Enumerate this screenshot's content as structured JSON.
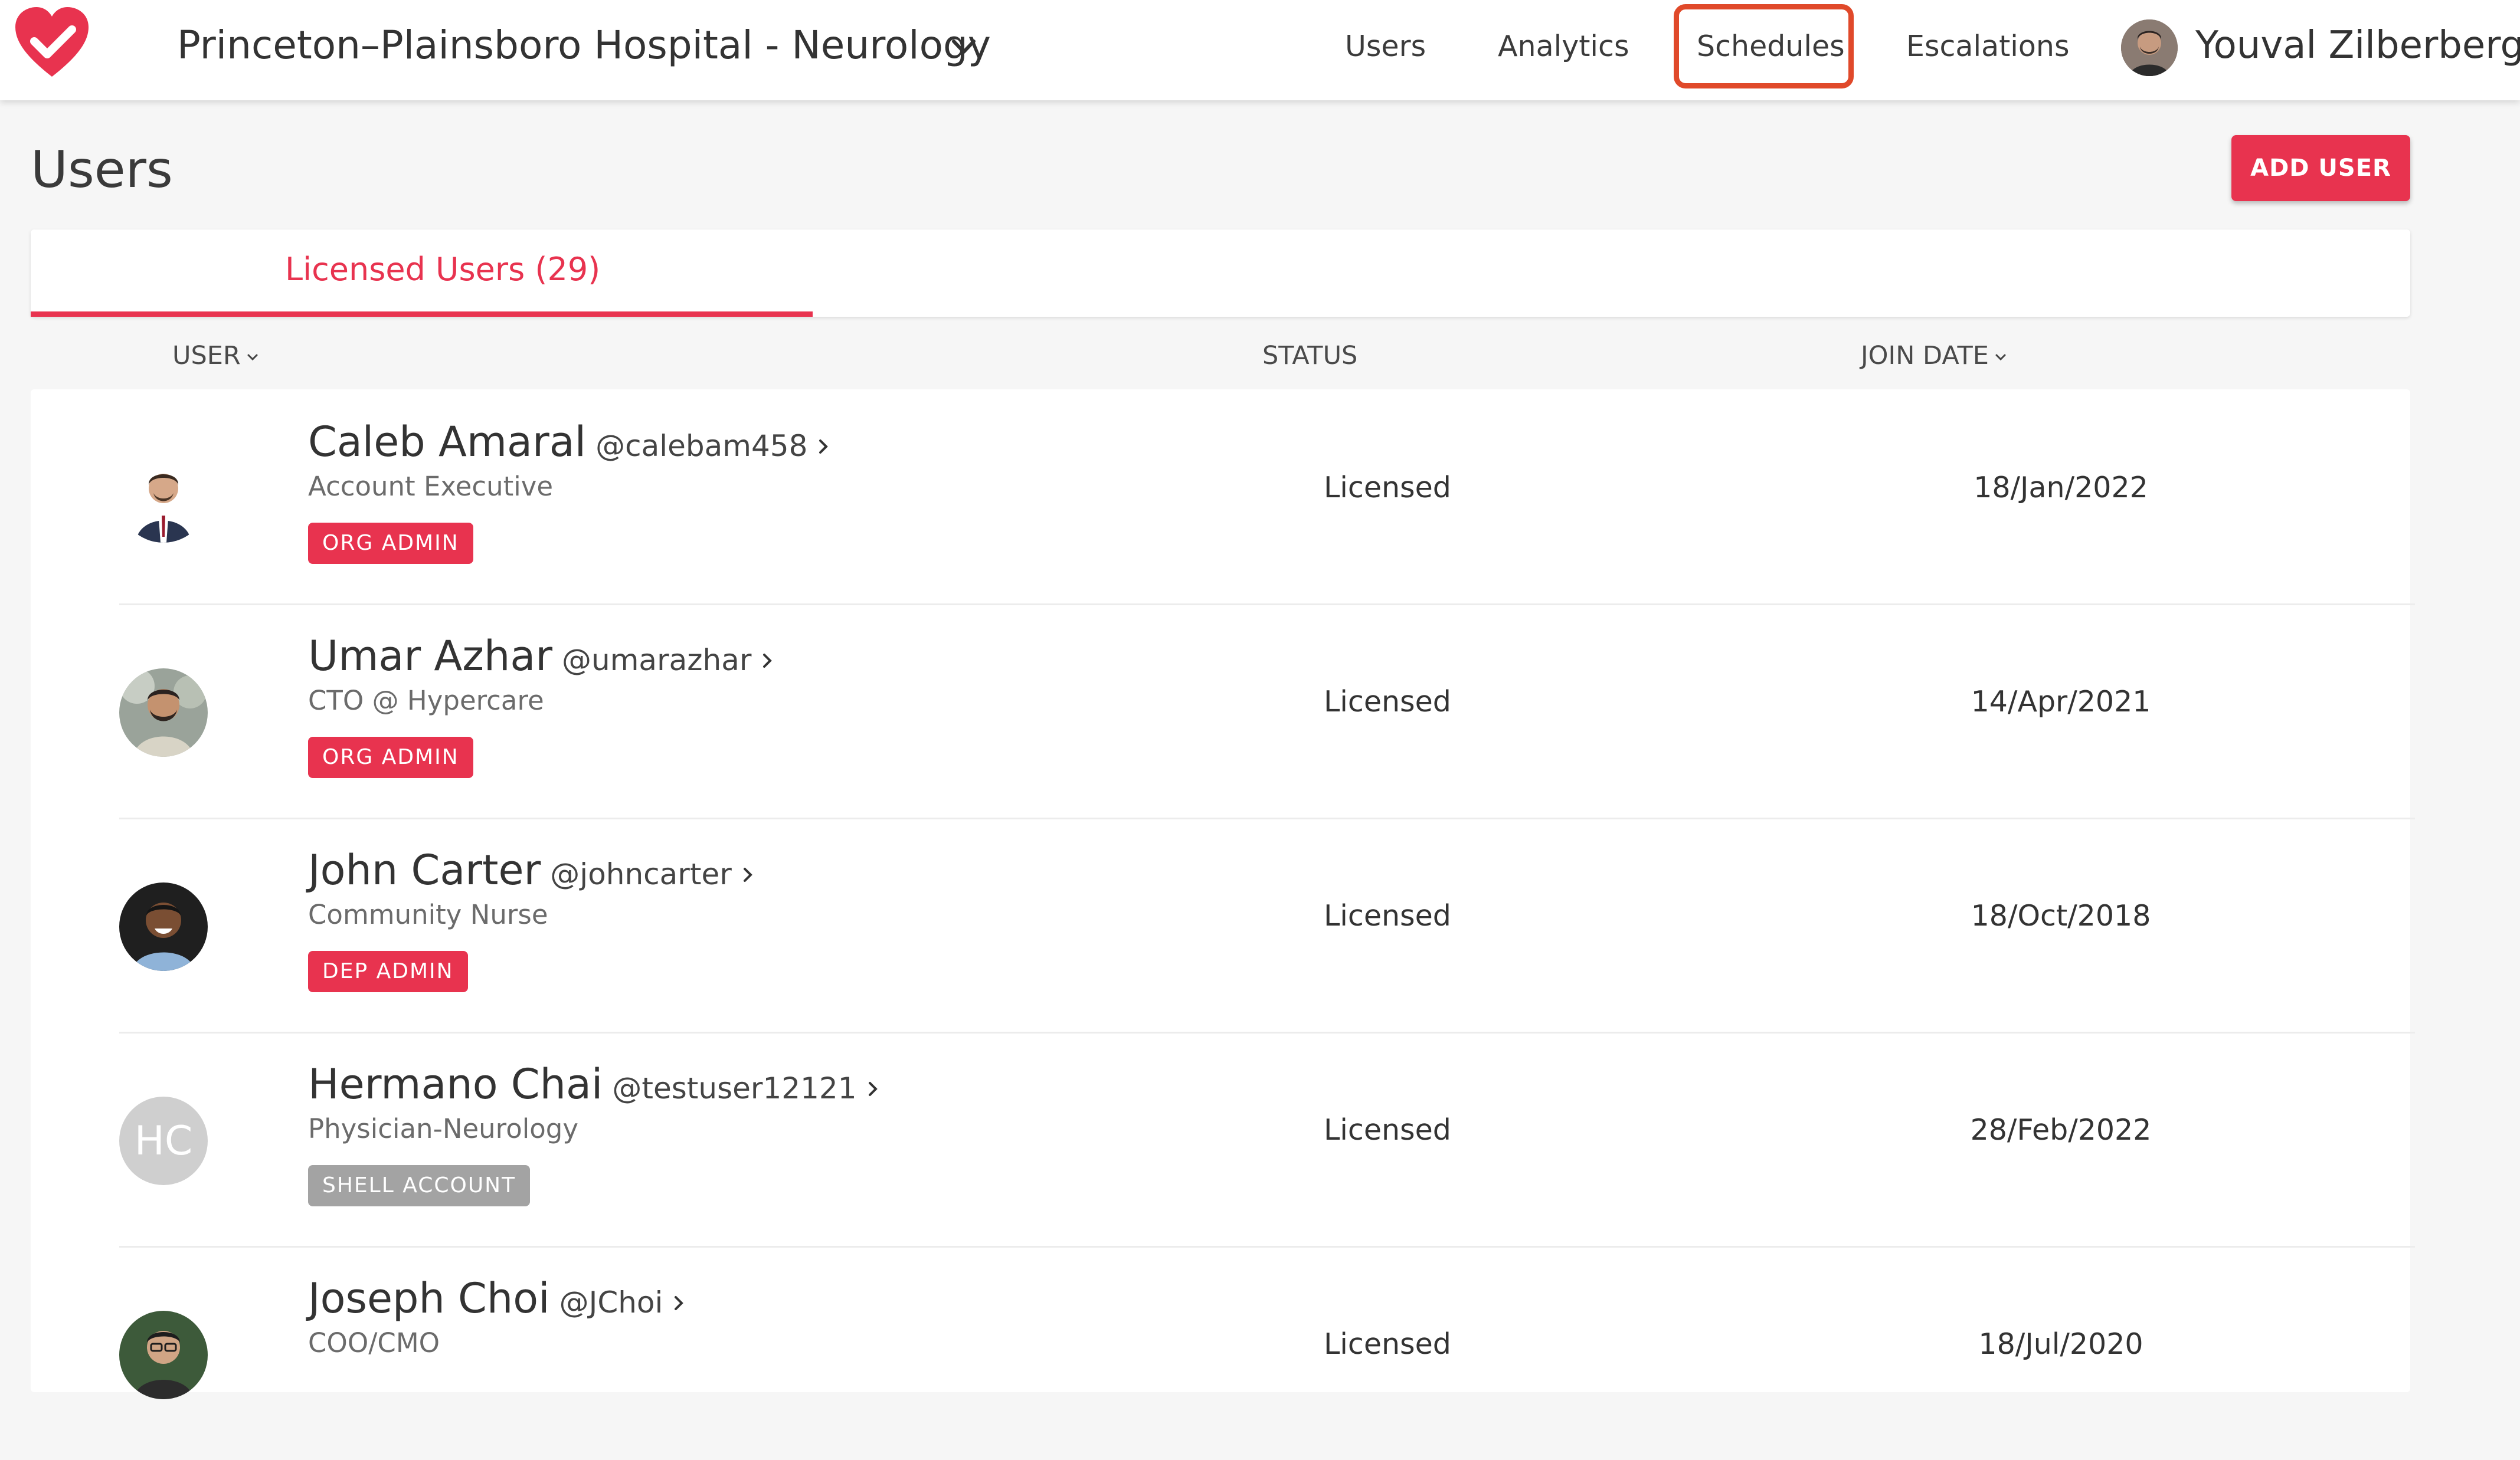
{
  "header": {
    "org_name": "Princeton–Plainsboro Hospital - Neurology",
    "nav": [
      {
        "label": "Users"
      },
      {
        "label": "Analytics"
      },
      {
        "label": "Schedules",
        "highlighted": true
      },
      {
        "label": "Escalations"
      }
    ],
    "user_name": "Youval Zilberberg"
  },
  "page": {
    "title": "Users",
    "add_user_label": "ADD USER"
  },
  "tabs": [
    {
      "label": "Licensed Users (29)",
      "active": true
    }
  ],
  "columns": {
    "user": "USER",
    "status": "STATUS",
    "join_date": "JOIN DATE"
  },
  "users": [
    {
      "name": "Caleb Amaral",
      "handle": "@calebam458",
      "title": "Account Executive",
      "badge": "ORG ADMIN",
      "badge_color": "#e8334f",
      "status": "Licensed",
      "join_date": "18/Jan/2022",
      "avatar": "photo"
    },
    {
      "name": "Umar Azhar",
      "handle": "@umarazhar",
      "title": "CTO @ Hypercare",
      "badge": "ORG ADMIN",
      "badge_color": "#e8334f",
      "status": "Licensed",
      "join_date": "14/Apr/2021",
      "avatar": "photo"
    },
    {
      "name": "John Carter",
      "handle": "@johncarter",
      "title": "Community Nurse",
      "badge": "DEP ADMIN",
      "badge_color": "#e8334f",
      "status": "Licensed",
      "join_date": "18/Oct/2018",
      "avatar": "photo"
    },
    {
      "name": "Hermano Chai",
      "handle": "@testuser12121",
      "title": "Physician-Neurology",
      "badge": "SHELL ACCOUNT",
      "badge_color": "#a3a3a3",
      "status": "Licensed",
      "join_date": "28/Feb/2022",
      "avatar_initials": "HC"
    },
    {
      "name": "Joseph Choi",
      "handle": "@JChoi",
      "title": "COO/CMO",
      "badge": "",
      "status": "Licensed",
      "join_date": "18/Jul/2020",
      "avatar": "photo"
    }
  ],
  "theme": {
    "accent": "#e8334f",
    "highlight_outline": "#e0492a",
    "shell_badge": "#a3a3a3"
  },
  "icons": {
    "logo": "heart-check-icon",
    "org_dropdown": "chevron-down-icon",
    "row_arrow": "chevron-right-icon",
    "sort": "sort-caret-icon"
  }
}
